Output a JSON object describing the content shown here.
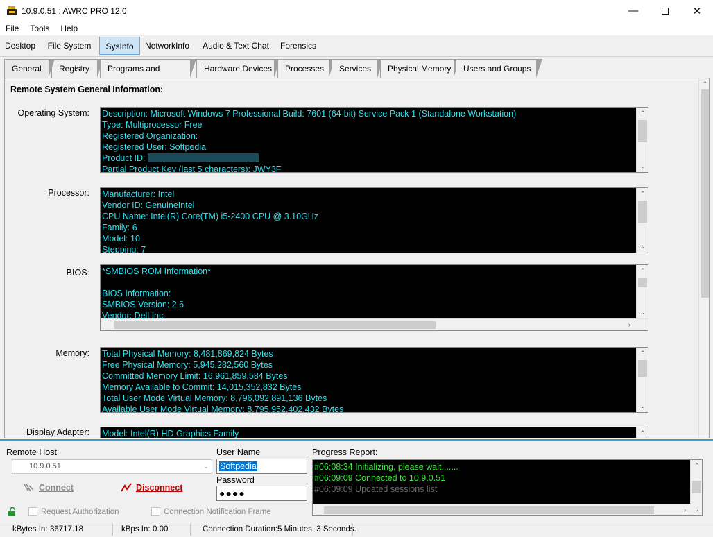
{
  "window": {
    "title": "10.9.0.51 : AWRC PRO 12.0"
  },
  "menu": [
    "File",
    "Tools",
    "Help"
  ],
  "top_tabs": [
    "Desktop",
    "File System",
    "SysInfo",
    "NetworkInfo",
    "Audio & Text Chat",
    "Forensics"
  ],
  "top_tab_active": "SysInfo",
  "sub_tabs": [
    "General",
    "Registry",
    "Programs and Updates",
    "Hardware Devices",
    "Processes",
    "Services",
    "Physical Memory",
    "Users and Groups"
  ],
  "sub_tab_active": "General",
  "panel": {
    "heading": "Remote System General Information:",
    "sections": [
      {
        "label": "Operating System:",
        "lines": [
          "Description: Microsoft Windows 7 Professional  Build: 7601 (64-bit) Service Pack 1 (Standalone Workstation)",
          "Type: Multiprocessor Free",
          "Registered Organization:",
          "Registered User: Softpedia",
          "Product ID:",
          "Partial Product Key (last 5 characters): JWY3F"
        ]
      },
      {
        "label": "Processor:",
        "lines": [
          "Manufacturer: Intel",
          "Vendor ID: GenuineIntel",
          "CPU Name: Intel(R) Core(TM) i5-2400 CPU @ 3.10GHz",
          "Family: 6",
          "Model: 10",
          "Stepping: 7"
        ]
      },
      {
        "label": "BIOS:",
        "lines": [
          "*SMBIOS ROM Information*",
          "",
          "BIOS Information:",
          "SMBIOS Version: 2.6",
          "Vendor: Dell Inc."
        ]
      },
      {
        "label": "Memory:",
        "lines": [
          "Total Physical Memory: 8,481,869,824 Bytes",
          "Free Physical Memory: 5,945,282,560 Bytes",
          "Committed Memory Limit: 16,961,859,584 Bytes",
          "Memory Available to Commit: 14,015,352,832 Bytes",
          "Total User Mode Virtual Memory: 8,796,092,891,136 Bytes",
          "Available User Mode Virtual Memory: 8,795,952,402,432 Bytes"
        ]
      },
      {
        "label": "Display Adapter:",
        "lines": [
          "Model: Intel(R) HD Graphics Family"
        ]
      }
    ]
  },
  "connection": {
    "remote_host_label": "Remote Host",
    "remote_host_value": "10.9.0.51",
    "connect_label": "Connect",
    "disconnect_label": "Disconnect",
    "user_name_label": "User Name",
    "user_name_value": "Softpedia",
    "password_label": "Password",
    "password_value": "●●●●",
    "request_auth_label": "Request Authorization",
    "notification_frame_label": "Connection Notification Frame",
    "progress_label": "Progress Report:",
    "progress_lines": [
      {
        "text": "#06:08:34 Initializing, please wait.......",
        "color": "#39e83b"
      },
      {
        "text": "#06:09:09 Connected to 10.9.0.51",
        "color": "#39e83b"
      },
      {
        "text": "#06:09:09 Updated sessions list",
        "color": "#6b6b6b"
      }
    ]
  },
  "status": {
    "kbytes_in_label": "kBytes In:",
    "kbytes_in_value": "36717.18",
    "kbps_in_label": "kBps In:",
    "kbps_in_value": "0.00",
    "duration_label": "Connection Duration:",
    "duration_value": "5 Minutes, 3 Seconds."
  },
  "colors": {
    "info_text": "#29e3ef",
    "accent": "#3c9fc8",
    "disconnect": "#c00000"
  }
}
